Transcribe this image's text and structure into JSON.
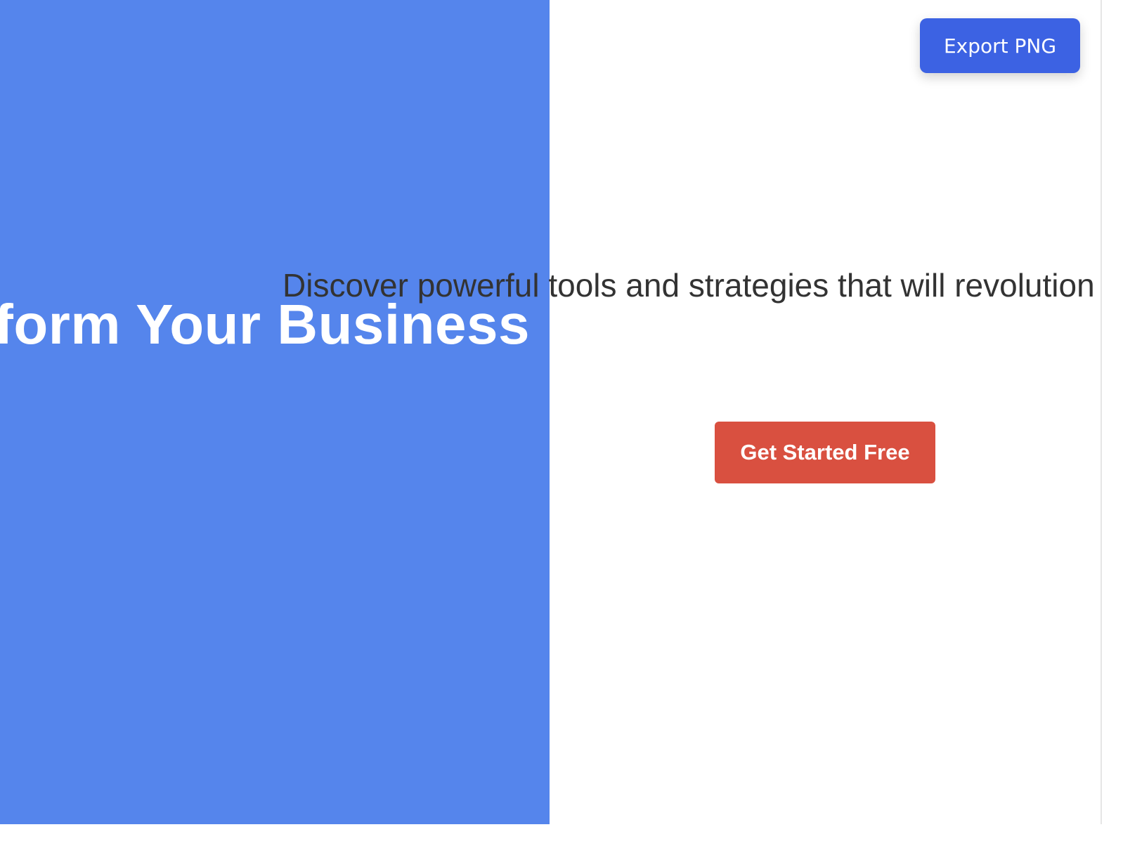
{
  "hero": {
    "title": "form Your Business",
    "subtitle": "Discover powerful tools and strategies that will revolution",
    "cta_label": "Get Started Free"
  },
  "toolbar": {
    "export_label": "Export PNG"
  },
  "colors": {
    "panel_blue": "#5585ec",
    "cta_red": "#d95040",
    "export_blue": "#3c62e3",
    "subtitle_text": "#333333"
  }
}
